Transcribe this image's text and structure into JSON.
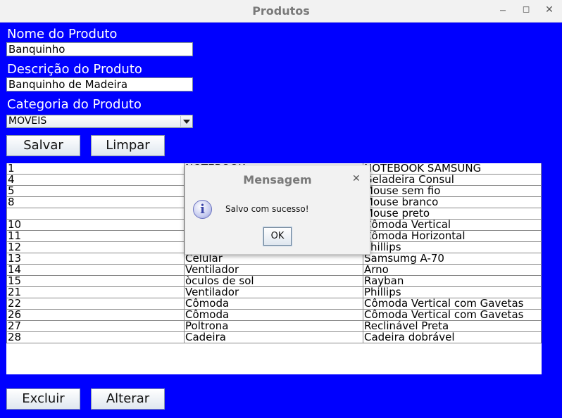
{
  "window": {
    "title": "Produtos"
  },
  "form": {
    "nome_label": "Nome do Produto",
    "nome_value": "Banquinho",
    "descricao_label": "Descrição do Produto",
    "descricao_value": "Banquinho de Madeira",
    "categoria_label": "Categoria do Produto",
    "categoria_value": "MOVEIS"
  },
  "buttons": {
    "salvar": "Salvar",
    "limpar": "Limpar",
    "excluir": "Excluir",
    "alterar": "Alterar"
  },
  "table": {
    "rows": [
      [
        "1",
        "NOTEBOOK",
        "NOTEBOOK SAMSUNG"
      ],
      [
        "4",
        "",
        "Geladeira Consul"
      ],
      [
        "5",
        "",
        "Mouse sem fio"
      ],
      [
        "8",
        "",
        "Mouse branco"
      ],
      [
        "",
        "",
        "Mouse preto"
      ],
      [
        "10",
        "",
        "Cômoda Vertical"
      ],
      [
        "11",
        "",
        "Cômoda Horizontal"
      ],
      [
        "12",
        "",
        "Phillips"
      ],
      [
        "13",
        "Celular",
        "Samsumg A-70"
      ],
      [
        "14",
        "Ventilador",
        "Arno"
      ],
      [
        "15",
        "òculos de sol",
        "Rayban"
      ],
      [
        "21",
        "Ventilador",
        "Phillips"
      ],
      [
        "22",
        "Cômoda",
        "Cômoda Vertical com Gavetas"
      ],
      [
        "26",
        "Cômoda",
        "Cômoda Vertical com Gavetas"
      ],
      [
        "27",
        "Poltrona",
        "Reclinável Preta"
      ],
      [
        "28",
        "Cadeira",
        "Cadeira dobrável"
      ]
    ]
  },
  "dialog": {
    "title": "Mensagem",
    "message": "Salvo com sucesso!",
    "ok_label": "OK",
    "icon": "info-icon"
  }
}
